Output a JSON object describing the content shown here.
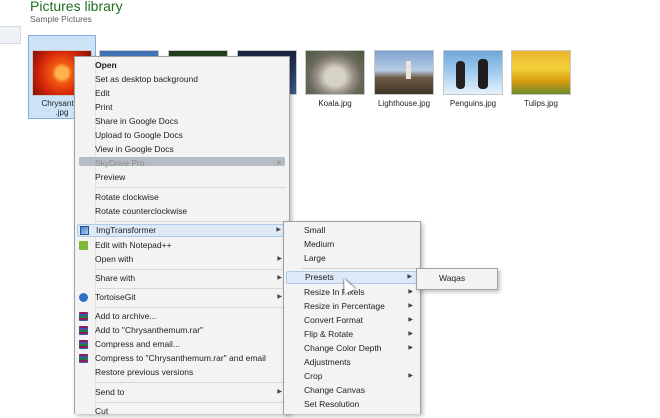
{
  "library": {
    "title": "Pictures library",
    "subtitle": "Sample Pictures"
  },
  "thumbnails": [
    {
      "caption": "Chrysanthe\n.jpg",
      "selected": true
    },
    {
      "caption": "Koala.jpg"
    },
    {
      "caption": "Lighthouse.jpg"
    },
    {
      "caption": "Penguins.jpg"
    },
    {
      "caption": "Tulips.jpg"
    }
  ],
  "context_menu": {
    "items": [
      {
        "label": "Open",
        "bold": true
      },
      {
        "label": "Set as desktop background"
      },
      {
        "label": "Edit"
      },
      {
        "label": "Print"
      },
      {
        "label": "Share in Google Docs"
      },
      {
        "label": "Upload to Google Docs"
      },
      {
        "label": "View in Google Docs"
      },
      {
        "label": "SkyDrive Pro",
        "disabled": true,
        "icon": "skydrive-icon"
      },
      {
        "label": "Preview"
      },
      {
        "label": "Rotate clockwise"
      },
      {
        "label": "Rotate counterclockwise"
      },
      {
        "label": "ImgTransformer",
        "icon": "imgtransformer-icon"
      },
      {
        "label": "Edit with Notepad++",
        "icon": "notepad-plus-plus-icon"
      },
      {
        "label": "Open with"
      },
      {
        "label": "Share with"
      },
      {
        "label": "TortoiseGit",
        "icon": "tortoisegit-icon"
      },
      {
        "label": "Add to archive...",
        "icon": "winrar-icon"
      },
      {
        "label": "Add to \"Chrysanthemum.rar\"",
        "icon": "winrar-icon"
      },
      {
        "label": "Compress and email...",
        "icon": "winrar-icon"
      },
      {
        "label": "Compress to \"Chrysanthemum.rar\" and email",
        "icon": "winrar-icon"
      },
      {
        "label": "Restore previous versions"
      },
      {
        "label": "Send to"
      },
      {
        "label": "Cut"
      }
    ]
  },
  "imgtransformer_menu": {
    "items": [
      {
        "label": "Small"
      },
      {
        "label": "Medium"
      },
      {
        "label": "Large"
      },
      {
        "label": "Presets"
      },
      {
        "label": "Resize In Pixels"
      },
      {
        "label": "Resize in Percentage"
      },
      {
        "label": "Convert Format"
      },
      {
        "label": "Flip & Rotate"
      },
      {
        "label": "Change Color Depth"
      },
      {
        "label": "Adjustments"
      },
      {
        "label": "Crop"
      },
      {
        "label": "Change Canvas"
      },
      {
        "label": "Set Resolution"
      }
    ]
  },
  "presets_menu": {
    "items": [
      {
        "label": "Waqas"
      }
    ]
  },
  "colors": {
    "library_title": "#1f6f20",
    "selection": "#cde3f7",
    "menu_bg": "#f3f3f3",
    "highlight": "#dde9f7"
  },
  "cursor": {
    "icon": "arrow-cursor-icon"
  }
}
